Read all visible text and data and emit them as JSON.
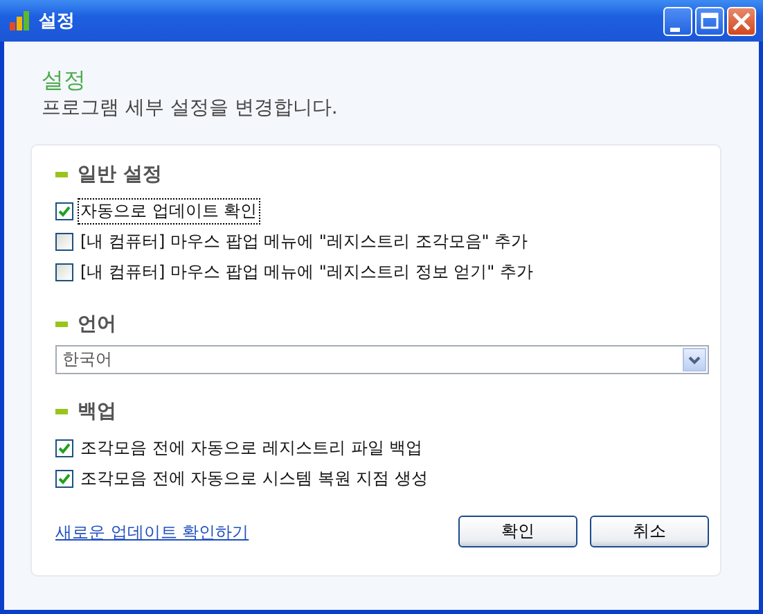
{
  "window": {
    "title": "설정"
  },
  "header": {
    "title": "설정",
    "subtitle": "프로그램 세부 설정을 변경합니다."
  },
  "sections": [
    {
      "kind": "checks",
      "title": "일반 설정",
      "items": [
        {
          "label": "자동으로 업데이트 확인",
          "checked": true,
          "focused": true
        },
        {
          "label": "[내 컴퓨터] 마우스 팝업 메뉴에 \"레지스트리 조각모음\" 추가",
          "checked": false,
          "focused": false
        },
        {
          "label": "[내 컴퓨터] 마우스 팝업 메뉴에 \"레지스트리 정보 얻기\" 추가",
          "checked": false,
          "focused": false
        }
      ]
    },
    {
      "kind": "select",
      "title": "언어",
      "value": "한국어"
    },
    {
      "kind": "checks",
      "title": "백업",
      "items": [
        {
          "label": "조각모음 전에 자동으로 레지스트리 파일 백업",
          "checked": true,
          "focused": false
        },
        {
          "label": "조각모음 전에 자동으로 시스템 복원 지점 생성",
          "checked": true,
          "focused": false
        }
      ]
    }
  ],
  "link": "새로운 업데이트 확인하기",
  "buttons": [
    "확인",
    "취소"
  ]
}
